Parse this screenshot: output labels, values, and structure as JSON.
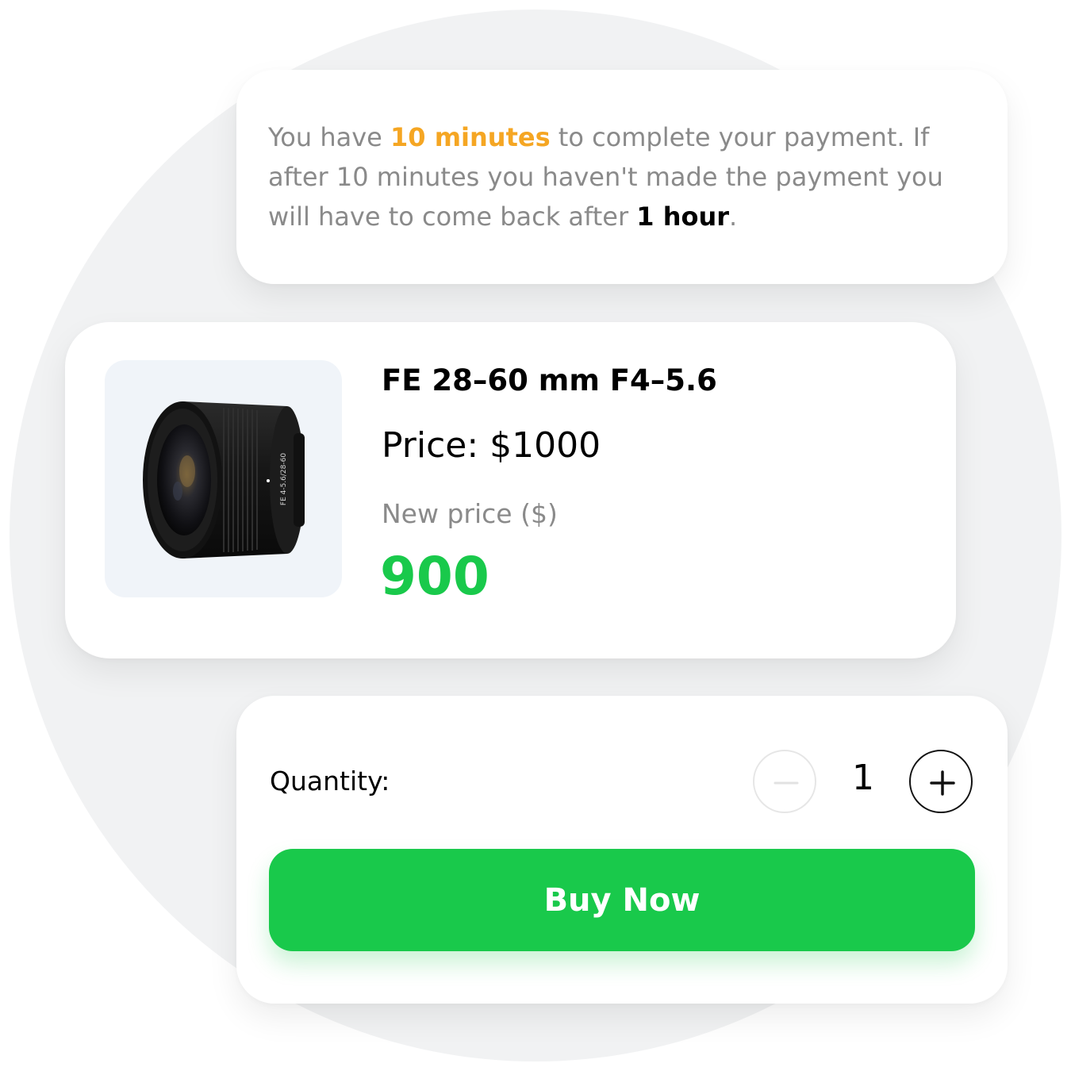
{
  "notice": {
    "text_1": "You have ",
    "time_limit": "10 minutes",
    "text_2": " to complete your payment. If after 10 minutes you haven't made the payment you will have to come back after ",
    "cooldown": "1 hour",
    "text_3": "."
  },
  "product": {
    "name": "FE 28–60 mm F4–5.6",
    "price_label": "Price: ",
    "price_value": "$1000",
    "new_price_label": "New price ($)",
    "new_price_value": "900",
    "image_icon": "camera-lens-image",
    "lens_text_1": "FE 4-5.6/28-60"
  },
  "checkout": {
    "quantity_label": "Quantity:",
    "quantity_value": "1",
    "decrement_icon": "minus-icon",
    "increment_icon": "plus-icon",
    "buy_label": "Buy Now"
  },
  "colors": {
    "accent_orange": "#f5a623",
    "accent_green": "#19c94b",
    "muted_text": "#8a8a8a"
  }
}
